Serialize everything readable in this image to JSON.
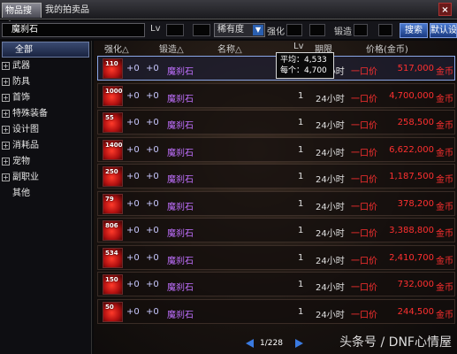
{
  "tabs": {
    "search": "物品搜索",
    "my_auctions": "我的拍卖品",
    "close": "×"
  },
  "searchbar": {
    "query": "魔刹石",
    "lv_label": "Lv",
    "rarity_value": "稀有度",
    "enhance_label": "强化",
    "forge_label": "锻造",
    "search_button": "搜索",
    "default_button": "默认设"
  },
  "sidebar": {
    "items": [
      {
        "label": "全部",
        "expandable": false
      },
      {
        "label": "武器",
        "expandable": true
      },
      {
        "label": "防具",
        "expandable": true
      },
      {
        "label": "首饰",
        "expandable": true
      },
      {
        "label": "特殊装备",
        "expandable": true
      },
      {
        "label": "设计图",
        "expandable": true
      },
      {
        "label": "消耗品",
        "expandable": true
      },
      {
        "label": "宠物",
        "expandable": true
      },
      {
        "label": "副职业",
        "expandable": true
      },
      {
        "label": "其他",
        "expandable": false
      }
    ]
  },
  "headers": {
    "enhance": "强化△",
    "forge": "锻造△",
    "name": "名称△",
    "lv": "Lv",
    "period": "期限",
    "price": "价格(金币)"
  },
  "tooltip": {
    "avg_label": "平均：",
    "avg_value": "4,533",
    "each_label": "每个：",
    "each_value": "4,700"
  },
  "rows": [
    {
      "qty": "110",
      "enhance": "+0",
      "forge": "+0",
      "name": "魔刹石",
      "count": "1",
      "time": "24小时",
      "price_label": "一口价",
      "price": "517,000",
      "currency": "金币"
    },
    {
      "qty": "1000",
      "enhance": "+0",
      "forge": "+0",
      "name": "魔刹石",
      "count": "1",
      "time": "24小时",
      "price_label": "一口价",
      "price": "4,700,000",
      "currency": "金币"
    },
    {
      "qty": "55",
      "enhance": "+0",
      "forge": "+0",
      "name": "魔刹石",
      "count": "1",
      "time": "24小时",
      "price_label": "一口价",
      "price": "258,500",
      "currency": "金币"
    },
    {
      "qty": "1400",
      "enhance": "+0",
      "forge": "+0",
      "name": "魔刹石",
      "count": "1",
      "time": "24小时",
      "price_label": "一口价",
      "price": "6,622,000",
      "currency": "金币"
    },
    {
      "qty": "250",
      "enhance": "+0",
      "forge": "+0",
      "name": "魔刹石",
      "count": "1",
      "time": "24小时",
      "price_label": "一口价",
      "price": "1,187,500",
      "currency": "金币"
    },
    {
      "qty": "79",
      "enhance": "+0",
      "forge": "+0",
      "name": "魔刹石",
      "count": "1",
      "time": "24小时",
      "price_label": "一口价",
      "price": "378,200",
      "currency": "金币"
    },
    {
      "qty": "806",
      "enhance": "+0",
      "forge": "+0",
      "name": "魔刹石",
      "count": "1",
      "time": "24小时",
      "price_label": "一口价",
      "price": "3,388,800",
      "currency": "金币"
    },
    {
      "qty": "534",
      "enhance": "+0",
      "forge": "+0",
      "name": "魔刹石",
      "count": "1",
      "time": "24小时",
      "price_label": "一口价",
      "price": "2,410,700",
      "currency": "金币"
    },
    {
      "qty": "150",
      "enhance": "+0",
      "forge": "+0",
      "name": "魔刹石",
      "count": "1",
      "time": "24小时",
      "price_label": "一口价",
      "price": "732,000",
      "currency": "金币"
    },
    {
      "qty": "50",
      "enhance": "+0",
      "forge": "+0",
      "name": "魔刹石",
      "count": "1",
      "time": "24小时",
      "price_label": "一口价",
      "price": "244,500",
      "currency": "金币"
    }
  ],
  "pager": {
    "text": "1/228"
  },
  "watermark": "头条号 / DNF心情屋"
}
